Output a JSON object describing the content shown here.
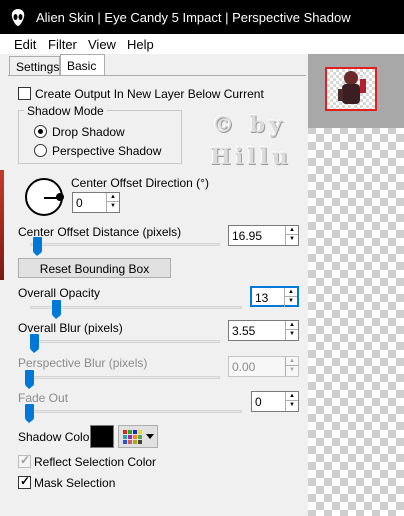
{
  "window": {
    "title": "Alien Skin | Eye Candy 5 Impact | Perspective Shadow",
    "app_icon": "alien-head-icon"
  },
  "menu": [
    "Edit",
    "Filter",
    "View",
    "Help"
  ],
  "tabs": [
    {
      "label": "Settings",
      "active": false
    },
    {
      "label": "Basic",
      "active": true
    }
  ],
  "options": {
    "create_output_label": "Create Output In New Layer Below Current",
    "create_output_checked": false
  },
  "shadow_mode": {
    "title": "Shadow Mode",
    "options": [
      {
        "label": "Drop Shadow",
        "selected": true
      },
      {
        "label": "Perspective Shadow",
        "selected": false
      }
    ]
  },
  "watermark": {
    "line1": "© by",
    "line2": "Hillu"
  },
  "center_offset_direction": {
    "label": "Center Offset Direction (°)",
    "value": "0",
    "icon": "direction-dial-icon"
  },
  "center_offset_distance": {
    "label": "Center Offset Distance (pixels)",
    "value": "16.95",
    "slider_fraction": 0.08
  },
  "reset_button_label": "Reset Bounding Box",
  "overall_opacity": {
    "label": "Overall Opacity",
    "value": "13",
    "slider_fraction": 0.13
  },
  "overall_blur": {
    "label": "Overall Blur (pixels)",
    "value": "3.55",
    "slider_fraction": 0.04
  },
  "perspective_blur": {
    "label": "Perspective Blur (pixels)",
    "value": "0.00",
    "slider_fraction": 0.0,
    "enabled": false
  },
  "fade_out": {
    "label": "Fade Out",
    "value": "0",
    "slider_fraction": 0.0
  },
  "shadow_color": {
    "label": "Shadow Color",
    "value": "#000000",
    "palette_icon": "color-palette-icon"
  },
  "reflect_selection_color": {
    "label": "Reflect Selection Color",
    "checked": true,
    "enabled": false
  },
  "mask_selection": {
    "label": "Mask Selection",
    "checked": true
  },
  "colors": {
    "accent": "#0078d7",
    "title_bg": "#000000",
    "preview_frame": "#e02020"
  }
}
